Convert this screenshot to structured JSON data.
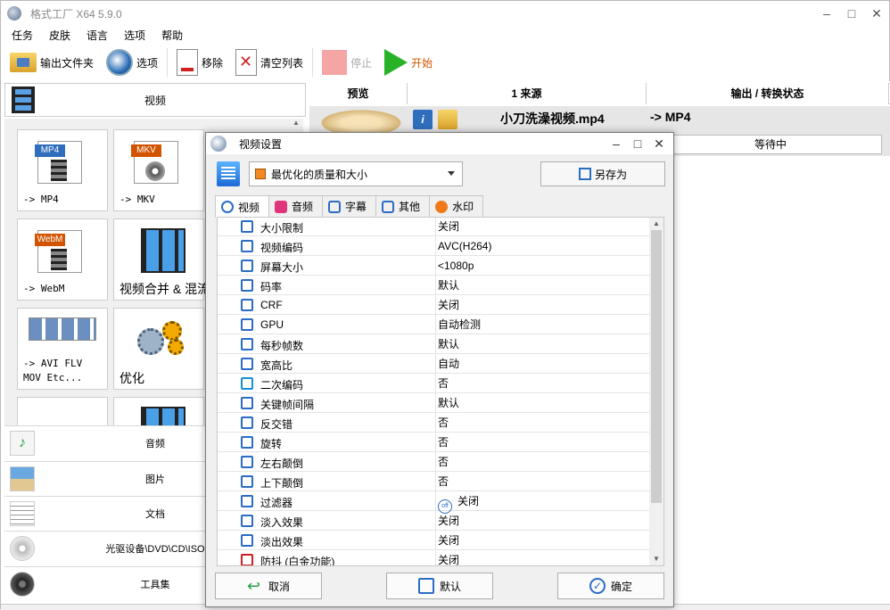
{
  "window": {
    "title": "格式工厂 X64 5.9.0",
    "controls": [
      "–",
      "□",
      "✕"
    ]
  },
  "menu": [
    "任务",
    "皮肤",
    "语言",
    "选项",
    "帮助"
  ],
  "toolbar": {
    "output_folder": "输出文件夹",
    "options": "选项",
    "remove": "移除",
    "clear_list": "清空列表",
    "stop": "停止",
    "start": "开始"
  },
  "left": {
    "video_category": "视频",
    "tiles": [
      {
        "label": "-> MP4",
        "badge": "MP4",
        "color": "#2f6ebd"
      },
      {
        "label": "-> MKV",
        "badge": "MKV",
        "color": "#d35400"
      },
      {
        "label": "-> WebM",
        "badge": "WebM",
        "color": "#d35400"
      },
      {
        "label": "视频合并 & 混流"
      },
      {
        "label": "-> AVI FLV\nMOV Etc..."
      },
      {
        "label": "优化"
      }
    ],
    "categories": [
      "音频",
      "图片",
      "文档",
      "光驱设备\\DVD\\CD\\ISO",
      "工具集"
    ]
  },
  "task_list": {
    "headers": [
      "预览",
      "1 来源",
      "输出 / 转换状态"
    ],
    "rows": [
      {
        "filename": "小刀洗澡视频.mp4",
        "output": "-> MP4",
        "status": "等待中"
      }
    ]
  },
  "dialog": {
    "title": "视频设置",
    "preset": "最优化的质量和大小",
    "save_as": "另存为",
    "tabs": [
      "视频",
      "音频",
      "字幕",
      "其他",
      "水印"
    ],
    "properties": [
      {
        "name": "大小限制",
        "value": "关闭",
        "icon_color": "#2b6cc4"
      },
      {
        "name": "视频编码",
        "value": "AVC(H264)",
        "icon_color": "#2b6cc4"
      },
      {
        "name": "屏幕大小",
        "value": "<1080p",
        "icon_color": "#2b6cc4"
      },
      {
        "name": "码率",
        "value": "默认",
        "icon_color": "#2b6cc4"
      },
      {
        "name": "CRF",
        "value": "关闭",
        "icon_color": "#2b6cc4"
      },
      {
        "name": "GPU",
        "value": "自动检测",
        "icon_color": "#2b6cc4"
      },
      {
        "name": "每秒帧数",
        "value": "默认",
        "icon_color": "#2b6cc4"
      },
      {
        "name": "宽高比",
        "value": "自动",
        "icon_color": "#2b6cc4"
      },
      {
        "name": "二次编码",
        "value": "否",
        "icon_color": "#1b8fd6"
      },
      {
        "name": "关键帧间隔",
        "value": "默认",
        "icon_color": "#2b6cc4"
      },
      {
        "name": "反交错",
        "value": "否",
        "icon_color": "#2b6cc4"
      },
      {
        "name": "旋转",
        "value": "否",
        "icon_color": "#2b6cc4"
      },
      {
        "name": "左右颠倒",
        "value": "否",
        "icon_color": "#2b6cc4"
      },
      {
        "name": "上下颠倒",
        "value": "否",
        "icon_color": "#2b6cc4"
      },
      {
        "name": "过滤器",
        "value": "关闭",
        "icon_color": "#2b6cc4",
        "off_badge": "off"
      },
      {
        "name": "淡入效果",
        "value": "关闭",
        "icon_color": "#2b6cc4"
      },
      {
        "name": "淡出效果",
        "value": "关闭",
        "icon_color": "#2b6cc4"
      },
      {
        "name": "防抖 (白金功能)",
        "value": "关闭",
        "icon_color": "#d02020"
      }
    ],
    "buttons": {
      "cancel": "取消",
      "default": "默认",
      "ok": "确定"
    }
  },
  "colors": {
    "accent": "#2b6cc4",
    "start": "#27b227",
    "stop": "#f6a5a5"
  }
}
